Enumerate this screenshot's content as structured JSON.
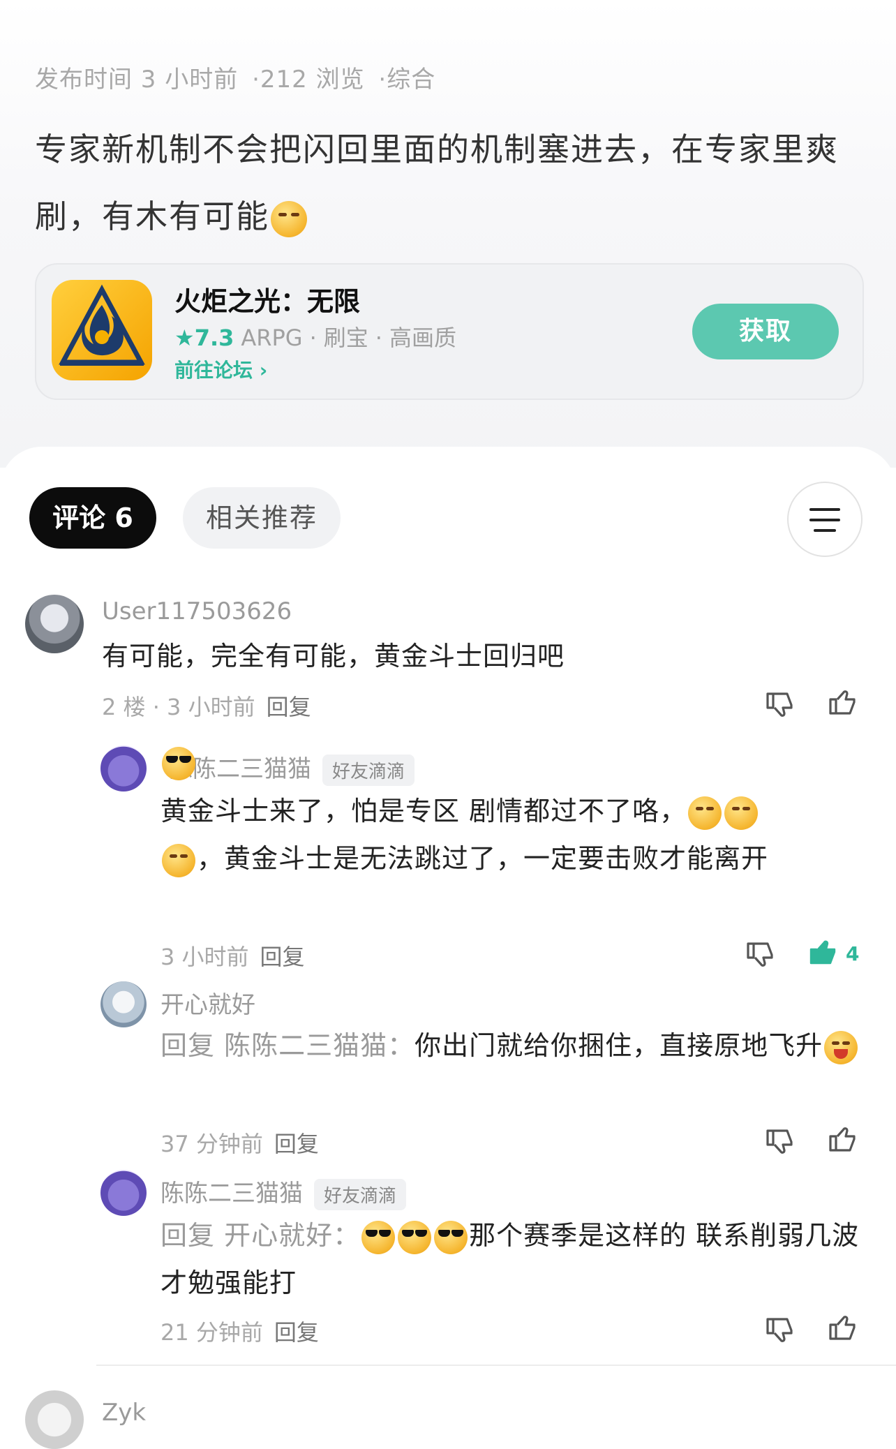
{
  "post": {
    "meta": [
      "发布时间 3 小时前",
      "·212 浏览",
      "·综合"
    ],
    "body": "专家新机制不会把闪回里面的机制塞进去，在专家里爽刷，有木有可能"
  },
  "app_card": {
    "name": "火炬之光：无限",
    "rating": "7.3",
    "tags": [
      "ARPG",
      "刷宝",
      "高画质"
    ],
    "forum_link": "前往论坛 ›",
    "get_button": "获取"
  },
  "tabs": {
    "comments": "评论 6",
    "related": "相关推荐"
  },
  "comments": [
    {
      "user": "User117503626",
      "text": "有可能，完全有可能，黄金斗士回归吧",
      "meta": "2 楼 · 3 小时前",
      "reply": "回复"
    },
    {
      "user": "陈陈二三猫猫",
      "tag": "好友滴滴",
      "text1": "黄金斗士来了，怕是专区 剧情都过不了咯，",
      "text2": "，黄金斗士是无法跳过了，一定要击败才能离开",
      "meta": "3 小时前",
      "reply": "回复",
      "likes": "4"
    },
    {
      "user": "开心就好",
      "prefix": "回复 陈陈二三猫猫：",
      "text": "你出门就给你捆住，直接原地飞升",
      "meta": "37 分钟前",
      "reply": "回复"
    },
    {
      "user": "陈陈二三猫猫",
      "tag": "好友滴滴",
      "prefix": "回复 开心就好：",
      "text": "那个赛季是这样的 联系削弱几波才勉强能打",
      "meta": "21 分钟前",
      "reply": "回复"
    },
    {
      "user": "Zyk"
    }
  ],
  "colors": {
    "accent": "#2fb79a",
    "button": "#5cc8b0"
  }
}
